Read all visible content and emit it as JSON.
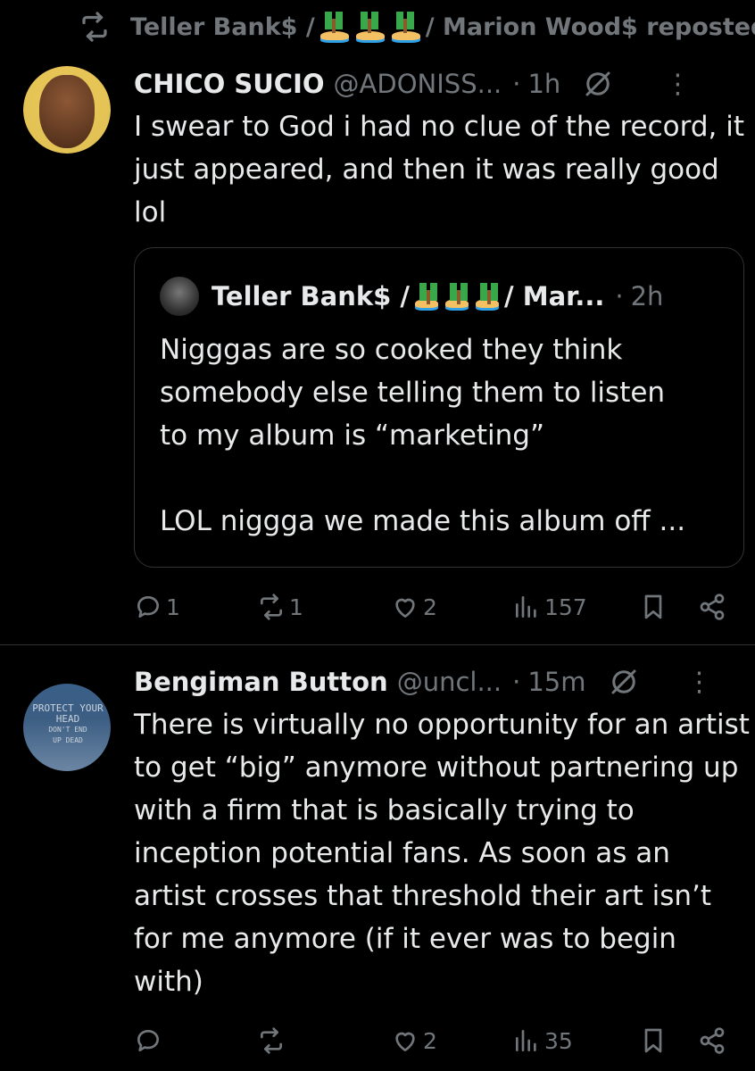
{
  "repost": {
    "text_before": "Teller Bank$ /",
    "text_after": "/ Marion Wood$ reposted",
    "icon": "repost-icon"
  },
  "tweets": [
    {
      "name": "CHICO SUCIO",
      "handle": "@ADONISS...",
      "time": "1h",
      "body": "I swear to God i had no clue of the record, it just appeared, and then it was really good lol",
      "quote": {
        "name_before": "Teller Bank$ /",
        "name_after": "/ Mar...",
        "time": "2h",
        "body_lines": [
          "Nigggas are so cooked they think",
          "somebody else telling them to listen",
          "to my album is “marketing”",
          "",
          "LOL niggga we made this album off ..."
        ]
      },
      "stats": {
        "replies": "1",
        "reposts": "1",
        "likes": "2",
        "views": "157"
      }
    },
    {
      "name": "Bengiman Button",
      "handle": "@uncl...",
      "time": "15m",
      "avatar_text": [
        "PROTECT YOUR",
        "HEAD",
        "DON'T END",
        "UP DEAD"
      ],
      "body": "There is virtually no opportunity for an artist to get “big” anymore without partnering up with a firm that is basically trying to inception potential fans. As soon as an artist crosses that threshold their art isn’t for me anymore (if it ever was to begin with)",
      "stats": {
        "replies": "",
        "reposts": "",
        "likes": "2",
        "views": "35"
      }
    }
  ],
  "colors": {
    "background": "#000000",
    "text": "#e7e9ea",
    "muted": "#71767b",
    "border": "#2f3336"
  },
  "dots": "·",
  "more": "⋮"
}
